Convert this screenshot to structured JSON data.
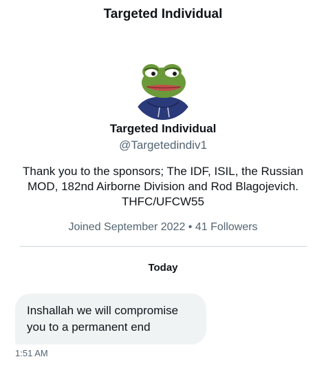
{
  "header": {
    "title": "Targeted Individual"
  },
  "profile": {
    "avatar_icon": "frog-avatar-icon",
    "name": "Targeted Individual",
    "handle": "@Targetedindiv1",
    "bio": "Thank you to the sponsors; The IDF, ISIL, the Russian MOD, 182nd Airborne Division and Rod Blagojevich. THFC/UFCW55",
    "meta": "Joined September 2022 • 41 Followers"
  },
  "conversation": {
    "date_label": "Today",
    "messages": [
      {
        "text": "Inshallah we will compromise you to a permanent end",
        "time": "1:51 AM"
      }
    ]
  },
  "colors": {
    "text_primary": "#0f1419",
    "text_secondary": "#536471",
    "bubble_bg": "#eff3f4",
    "divider": "#cfd9de",
    "hoodie": "#2b3a7a",
    "skin": "#6b9a3a"
  }
}
